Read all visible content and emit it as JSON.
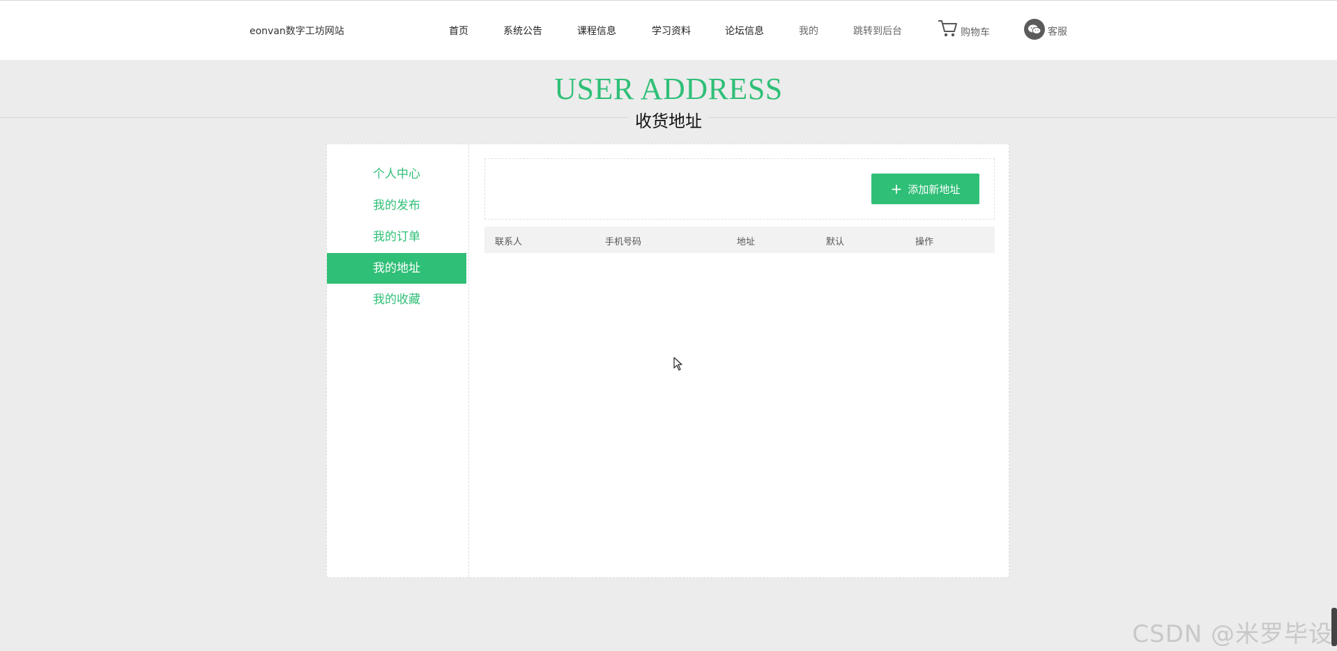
{
  "header": {
    "site_title": "eonvan数字工坊网站",
    "nav": [
      {
        "label": "首页"
      },
      {
        "label": "系统公告"
      },
      {
        "label": "课程信息"
      },
      {
        "label": "学习资料"
      },
      {
        "label": "论坛信息"
      },
      {
        "label": "我的"
      },
      {
        "label": "跳转到后台"
      }
    ],
    "cart_label": "购物车",
    "service_label": "客服"
  },
  "hero": {
    "title_en": "USER ADDRESS",
    "title_zh": "收货地址"
  },
  "sidebar": {
    "items": [
      {
        "label": "个人中心"
      },
      {
        "label": "我的发布"
      },
      {
        "label": "我的订单"
      },
      {
        "label": "我的地址",
        "active": true
      },
      {
        "label": "我的收藏"
      }
    ]
  },
  "address": {
    "add_button_label": "添加新地址",
    "columns": [
      "联系人",
      "手机号码",
      "地址",
      "默认",
      "操作"
    ],
    "rows": []
  },
  "watermark": "CSDN @米罗毕设",
  "colors": {
    "accent": "#2fbf77",
    "page_bg": "#ececec"
  }
}
